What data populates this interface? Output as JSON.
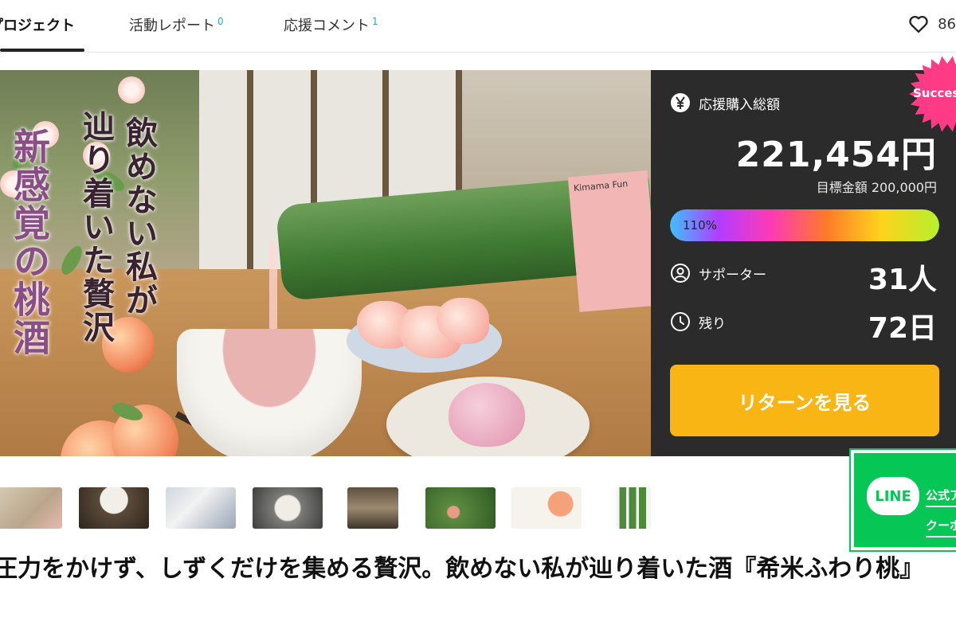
{
  "tabs": [
    {
      "label": "プロジェクト",
      "count": ""
    },
    {
      "label": "活動レポート",
      "count": "0"
    },
    {
      "label": "応援コメント",
      "count": "1"
    }
  ],
  "favorite_count": "86",
  "hero": {
    "text_right": "飲めない私が",
    "text_mid": "辿り着いた贅沢",
    "text_left": "新感覚の桃酒",
    "bottle_label": "Kimama Fun"
  },
  "panel": {
    "total_label": "応援購入総額",
    "total_value": "221,454円",
    "target_text": "目標金額 200,000円",
    "progress_text": "110%",
    "progress_percent": 110,
    "supporters_label": "サポーター",
    "supporters_value": "31人",
    "remaining_label": "残り",
    "remaining_value": "72日",
    "cta_label": "リターンを見る",
    "badge": "Success"
  },
  "line_banner": {
    "logo": "LINE",
    "line1": "公式ア",
    "line2": "クーポ"
  },
  "title": "圧力をかけず、しずくだけを集める贅沢。飲めない私が辿り着いた酒『希米ふわり桃』",
  "colors": {
    "panel_bg": "#2b2b2b",
    "cta": "#f8b513",
    "badge": "#ff3b86",
    "line_green": "#06c755"
  }
}
